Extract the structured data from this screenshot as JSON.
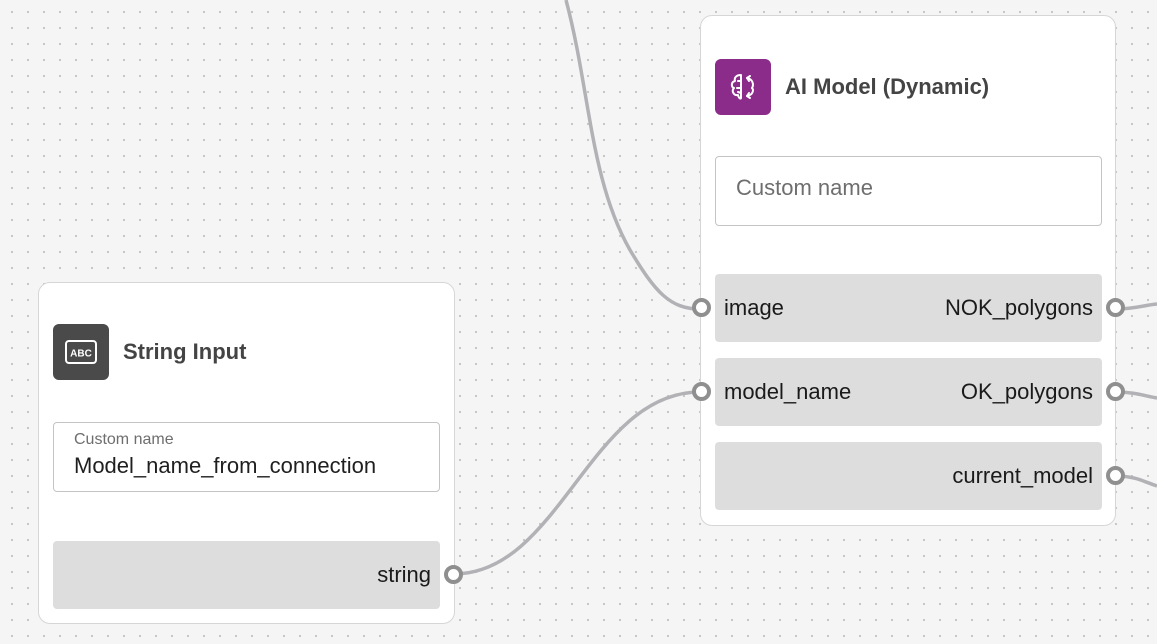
{
  "nodes": {
    "ai_model": {
      "title": "AI Model (Dynamic)",
      "icon": "brain-sync-icon",
      "icon_color": "#8b2c8b",
      "custom_name_placeholder": "Custom name",
      "ports": [
        {
          "input": "image",
          "output": "NOK_polygons"
        },
        {
          "input": "model_name",
          "output": "OK_polygons"
        },
        {
          "input": "",
          "output": "current_model"
        }
      ]
    },
    "string_input": {
      "title": "String Input",
      "icon": "abc-text-icon",
      "icon_color": "#4a4a4a",
      "icon_text": "ABC",
      "custom_name_label": "Custom name",
      "custom_name_value": "Model_name_from_connection",
      "output_port": "string"
    }
  },
  "connections": [
    {
      "from": "offscreen-top",
      "to": "ai_model.image"
    },
    {
      "from": "string_input.string",
      "to": "ai_model.model_name"
    },
    {
      "from": "ai_model.NOK_polygons",
      "to": "offscreen-right"
    },
    {
      "from": "ai_model.OK_polygons",
      "to": "offscreen-right"
    },
    {
      "from": "ai_model.current_model",
      "to": "offscreen-right"
    }
  ],
  "colors": {
    "canvas": "#f5f5f5",
    "wire": "#b2b2b6",
    "port_row": "#dddddd",
    "handle": "#8f8f8f"
  }
}
